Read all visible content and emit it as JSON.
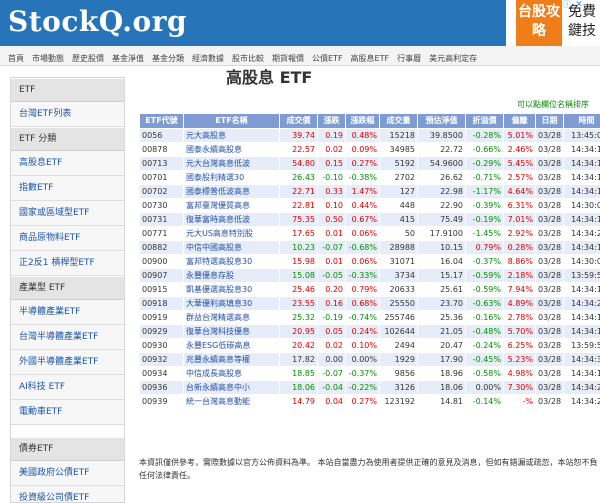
{
  "header": {
    "logo": "StockQ.org",
    "ad": {
      "left_text": "台股攻略",
      "right_text": "免費鍵技"
    }
  },
  "nav": {
    "items": [
      "首頁",
      "市場動態",
      "歷史股價",
      "基金淨值",
      "基金分類",
      "經濟數據",
      "股市比較",
      "期貨報價",
      "公債ETF",
      "高股息ETF",
      "行事曆",
      "美元高利定存"
    ]
  },
  "sidebar": {
    "sections": [
      {
        "header": "ETF",
        "items": [
          "台灣ETF列表"
        ]
      },
      {
        "header": "ETF 分類",
        "items": [
          "高股息ETF",
          "指數ETF",
          "國家或區域型ETF",
          "商品原物料ETF",
          "正2反1 槓桿型ETF"
        ]
      },
      {
        "header": "產業型 ETF",
        "items": [
          "半導體產業ETF",
          "台灣半導體產業ETF",
          "外國半導體產業ETF",
          "AI科技 ETF",
          "電動車ETF"
        ]
      },
      {
        "header": "債券ETF",
        "items": [
          "美國政府公債ETF",
          "投資級公司債ETF"
        ]
      }
    ]
  },
  "main": {
    "title": "高股息 ETF",
    "sort_hint": "可以點欄位名稱排序",
    "table": {
      "columns": [
        "ETF代號",
        "ETF名稱",
        "成交價",
        "漲跌",
        "漲跌幅",
        "成交量",
        "預估淨值",
        "折溢價",
        "偏離",
        "日期",
        "時間"
      ],
      "rows": [
        {
          "code": "0056",
          "name": "元大高股息",
          "price": "39.74",
          "chg": "0.19",
          "pct": "0.48%",
          "vol": "15218",
          "nav": "39.8500",
          "prem": "-0.28%",
          "dev": "5.01%",
          "date": "03/28",
          "time": "13:45:00"
        },
        {
          "code": "00878",
          "name": "國泰永續高股息",
          "price": "22.57",
          "chg": "0.02",
          "pct": "0.09%",
          "vol": "34985",
          "nav": "22.72",
          "prem": "-0.66%",
          "dev": "2.46%",
          "date": "03/28",
          "time": "14:34:14"
        },
        {
          "code": "00713",
          "name": "元大台灣高息低波",
          "price": "54.80",
          "chg": "0.15",
          "pct": "0.27%",
          "vol": "5192",
          "nav": "54.9600",
          "prem": "-0.29%",
          "dev": "5.45%",
          "date": "03/28",
          "time": "14:34:16"
        },
        {
          "code": "00701",
          "name": "國泰股利精選30",
          "price": "26.43",
          "chg": "-0.10",
          "pct": "-0.38%",
          "vol": "2702",
          "nav": "26.62",
          "prem": "-0.71%",
          "dev": "2.57%",
          "date": "03/28",
          "time": "14:34:15"
        },
        {
          "code": "00702",
          "name": "國泰標普低波高息",
          "price": "22.71",
          "chg": "0.33",
          "pct": "1.47%",
          "vol": "127",
          "nav": "22.98",
          "prem": "-1.17%",
          "dev": "4.64%",
          "date": "03/28",
          "time": "14:34:17"
        },
        {
          "code": "00730",
          "name": "富邦臺灣優質高息",
          "price": "22.81",
          "chg": "0.10",
          "pct": "0.44%",
          "vol": "448",
          "nav": "22.90",
          "prem": "-0.39%",
          "dev": "6.31%",
          "date": "03/28",
          "time": "14:30:07"
        },
        {
          "code": "00731",
          "name": "復華富時高息低波",
          "price": "75.35",
          "chg": "0.50",
          "pct": "0.67%",
          "vol": "415",
          "nav": "75.49",
          "prem": "-0.19%",
          "dev": "7.01%",
          "date": "03/28",
          "time": "14:34:17"
        },
        {
          "code": "00771",
          "name": "元大US高息特別股",
          "price": "17.65",
          "chg": "0.01",
          "pct": "0.06%",
          "vol": "50",
          "nav": "17.9100",
          "prem": "-1.45%",
          "dev": "2.92%",
          "date": "03/28",
          "time": "14:34:20"
        },
        {
          "code": "00882",
          "name": "中信中國高股息",
          "price": "10.23",
          "chg": "-0.07",
          "pct": "-0.68%",
          "vol": "28988",
          "nav": "10.15",
          "prem": "0.79%",
          "dev": "0.28%",
          "date": "03/28",
          "time": "14:34:14"
        },
        {
          "code": "00900",
          "name": "富邦特選高股息30",
          "price": "15.98",
          "chg": "0.01",
          "pct": "0.06%",
          "vol": "31071",
          "nav": "16.04",
          "prem": "-0.37%",
          "dev": "8.86%",
          "date": "03/28",
          "time": "14:30:07"
        },
        {
          "code": "00907",
          "name": "永豐優息存股",
          "price": "15.08",
          "chg": "-0.05",
          "pct": "-0.33%",
          "vol": "3734",
          "nav": "15.17",
          "prem": "-0.59%",
          "dev": "2.18%",
          "date": "03/28",
          "time": "13:59:57"
        },
        {
          "code": "00915",
          "name": "凱基優選高股息30",
          "price": "25.46",
          "chg": "0.20",
          "pct": "0.79%",
          "vol": "20633",
          "nav": "25.61",
          "prem": "-0.59%",
          "dev": "7.94%",
          "date": "03/28",
          "time": "14:34:15"
        },
        {
          "code": "00918",
          "name": "大華優利高填息30",
          "price": "23.55",
          "chg": "0.16",
          "pct": "0.68%",
          "vol": "25550",
          "nav": "23.70",
          "prem": "-0.63%",
          "dev": "4.89%",
          "date": "03/28",
          "time": "14:34:23"
        },
        {
          "code": "00919",
          "name": "群益台灣精選高息",
          "price": "25.32",
          "chg": "-0.19",
          "pct": "-0.74%",
          "vol": "255746",
          "nav": "25.36",
          "prem": "-0.16%",
          "dev": "2.78%",
          "date": "03/28",
          "time": "14:34:19"
        },
        {
          "code": "00929",
          "name": "復華台灣科技優息",
          "price": "20.95",
          "chg": "0.05",
          "pct": "0.24%",
          "vol": "102644",
          "nav": "21.05",
          "prem": "-0.48%",
          "dev": "5.70%",
          "date": "03/28",
          "time": "14:34:17"
        },
        {
          "code": "00930",
          "name": "永豐ESG低碳高息",
          "price": "20.42",
          "chg": "0.02",
          "pct": "0.10%",
          "vol": "2494",
          "nav": "20.47",
          "prem": "-0.24%",
          "dev": "6.25%",
          "date": "03/28",
          "time": "13:59:57"
        },
        {
          "code": "00932",
          "name": "兆豐永續高息等權",
          "price": "17.82",
          "chg": "0.00",
          "pct": "0.00%",
          "vol": "1929",
          "nav": "17.90",
          "prem": "-0.45%",
          "dev": "5.23%",
          "date": "03/28",
          "time": "14:34:31"
        },
        {
          "code": "00934",
          "name": "中信成長高股息",
          "price": "18.85",
          "chg": "-0.07",
          "pct": "-0.37%",
          "vol": "9856",
          "nav": "18.96",
          "prem": "-0.58%",
          "dev": "4.98%",
          "date": "03/28",
          "time": "14:34:14"
        },
        {
          "code": "00936",
          "name": "台新永續高息中小",
          "price": "18.06",
          "chg": "-0.04",
          "pct": "-0.22%",
          "vol": "3126",
          "nav": "18.06",
          "prem": "0.00%",
          "dev": "7.30%",
          "date": "03/28",
          "time": "14:34:27"
        },
        {
          "code": "00939",
          "name": "統一台灣高息動能",
          "price": "14.79",
          "chg": "0.04",
          "pct": "0.27%",
          "vol": "123192",
          "nav": "14.81",
          "prem": "-0.14%",
          "dev": "-%",
          "date": "03/28",
          "time": "14:34:27"
        }
      ]
    },
    "disclaimer": "本資訊僅供參考，實際數據以官方公佈資料為準。 本站自當盡力為使用者提供正確的意見及消息，但如有錯漏或疏忽，本站恕不負任何法律責任。"
  }
}
